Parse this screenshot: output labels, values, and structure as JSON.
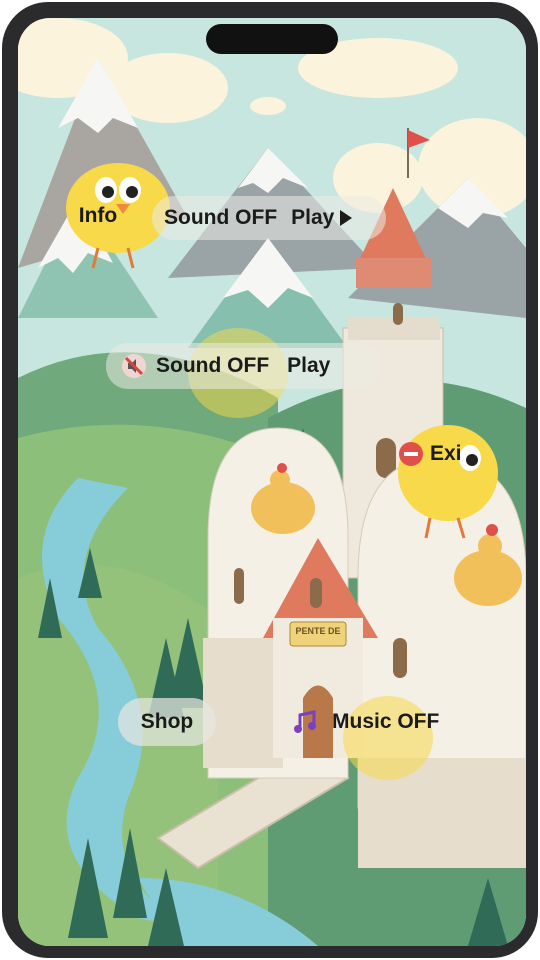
{
  "menu": {
    "info_label": "Info",
    "sound_off_label_1": "Sound OFF",
    "play_label_1": "Play",
    "sound_off_label_2": "Sound OFF",
    "play_label_2": "Play",
    "exit_label": "Exi",
    "shop_label": "Shop",
    "music_off_label": "Music OFF"
  },
  "castle": {
    "sign_text": "PENTE DE"
  },
  "colors": {
    "sky": "#bfe3df",
    "chick": "#f7d94c",
    "roof": "#e07a5f",
    "river": "#7cc9d6",
    "grass": "#7cb86a"
  }
}
